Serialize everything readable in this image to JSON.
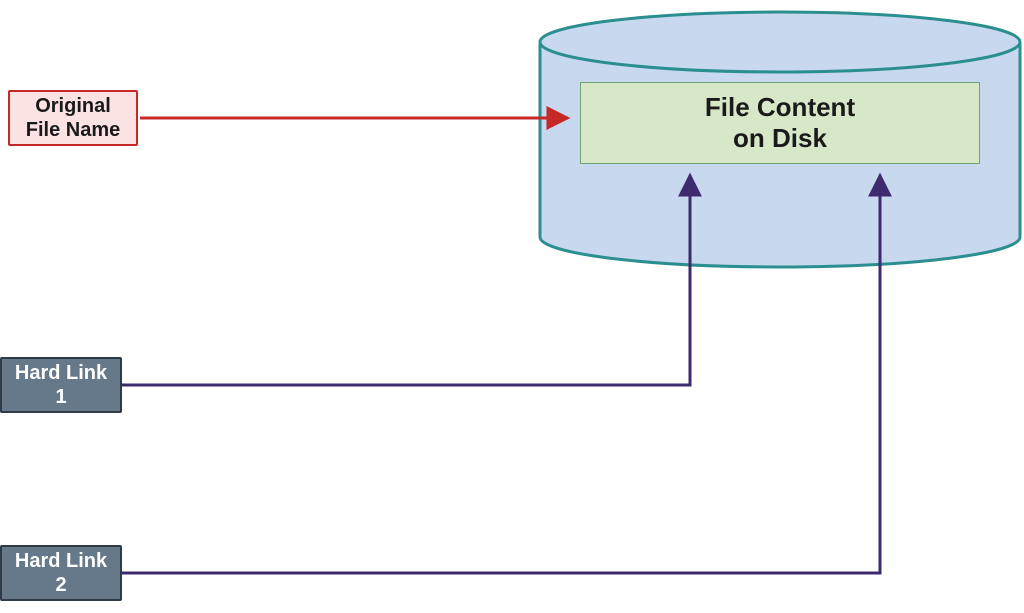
{
  "nodes": {
    "original": {
      "line1": "Original",
      "line2": "File Name"
    },
    "hardlink1": {
      "line1": "Hard Link",
      "line2": "1"
    },
    "hardlink2": {
      "line1": "Hard Link",
      "line2": "2"
    },
    "content": {
      "line1": "File Content",
      "line2": "on Disk"
    }
  },
  "colors": {
    "redArrow": "#c62828",
    "purpleArrow": "#3e2a6e",
    "diskFill": "#c7d8ef",
    "diskStroke": "#2c8f8f"
  },
  "edges": [
    {
      "from": "original",
      "to": "content",
      "color": "red"
    },
    {
      "from": "hardlink1",
      "to": "content",
      "color": "purple"
    },
    {
      "from": "hardlink2",
      "to": "content",
      "color": "purple"
    }
  ]
}
